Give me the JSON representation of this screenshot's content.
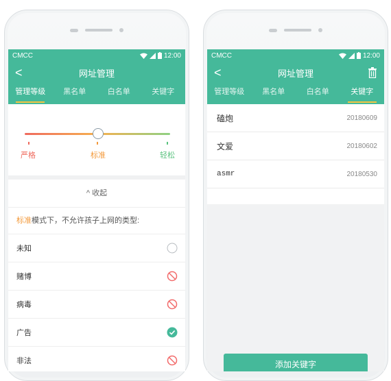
{
  "left_phone": {
    "status": {
      "carrier": "CMCC",
      "time": "12:00"
    },
    "nav": {
      "back": "<",
      "title": "网址管理"
    },
    "tabs": [
      "管理等级",
      "黑名单",
      "白名单",
      "关键字"
    ],
    "levels": {
      "strict": "严格",
      "standard": "标准",
      "loose": "轻松",
      "selected": "标准"
    },
    "collapse_label": "^ 收起",
    "description": {
      "highlight": "标准",
      "rest": "模式下，不允许孩子上网的类型:"
    },
    "categories": [
      {
        "label": "未知",
        "state": "allowed"
      },
      {
        "label": "赌博",
        "state": "blocked"
      },
      {
        "label": "病毒",
        "state": "blocked"
      },
      {
        "label": "广告",
        "state": "checked"
      },
      {
        "label": "非法",
        "state": "blocked"
      }
    ]
  },
  "right_phone": {
    "status": {
      "carrier": "CMCC",
      "time": "12:00"
    },
    "nav": {
      "back": "<",
      "title": "网址管理"
    },
    "tabs": [
      "管理等级",
      "黑名单",
      "白名单",
      "关键字"
    ],
    "keywords": [
      {
        "word": "磕炮",
        "date": "20180609"
      },
      {
        "word": "文爱",
        "date": "20180602"
      },
      {
        "word": "asmr",
        "date": "20180530"
      }
    ],
    "add_button": "添加关键字"
  },
  "colors": {
    "accent": "#45b99a",
    "strict": "#ef6b5e",
    "standard": "#f39a3c",
    "loose": "#59c27e",
    "blocked": "#f26a6a",
    "tab_underline": "#f5c542"
  },
  "icons": {
    "signal": "signal-icon",
    "battery": "battery-icon",
    "trash": "trash-icon",
    "blocked": "prohibited-icon",
    "checked": "check-circle-icon",
    "empty": "empty-circle-icon"
  }
}
